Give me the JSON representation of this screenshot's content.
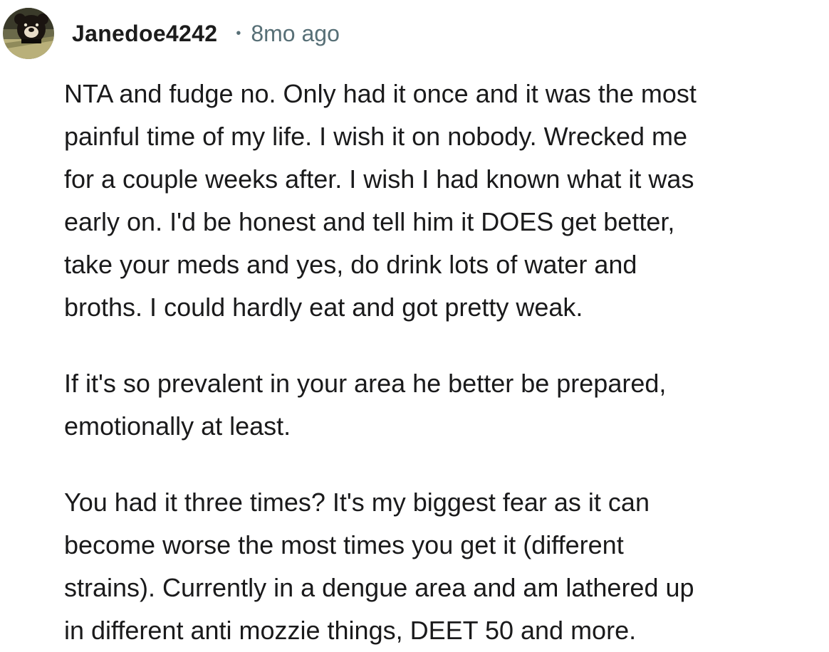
{
  "comment": {
    "author": "Janedoe4242",
    "separator": "•",
    "timestamp": "8mo ago",
    "avatar_icon": "bear-avatar-icon",
    "paragraphs": [
      "NTA and fudge no. Only had it once and it was the most\npainful time of my life. I wish it on nobody. Wrecked me\nfor a couple weeks after. I wish I had known what it was\nearly on. I'd be honest and tell him it DOES get better,\ntake your meds and yes, do drink lots of water and\nbroths. I could hardly eat and got pretty weak.",
      "If it's so prevalent in your area he better be prepared,\nemotionally at least.",
      "You had it three times? It's my biggest fear as it can\nbecome worse the most times you get it (different\nstrains). Currently in a dengue area and am lathered up\nin different anti mozzie things, DEET 50 and more."
    ]
  },
  "colors": {
    "text": "#1a1a1b",
    "meta": "#576f76",
    "background": "#ffffff"
  }
}
